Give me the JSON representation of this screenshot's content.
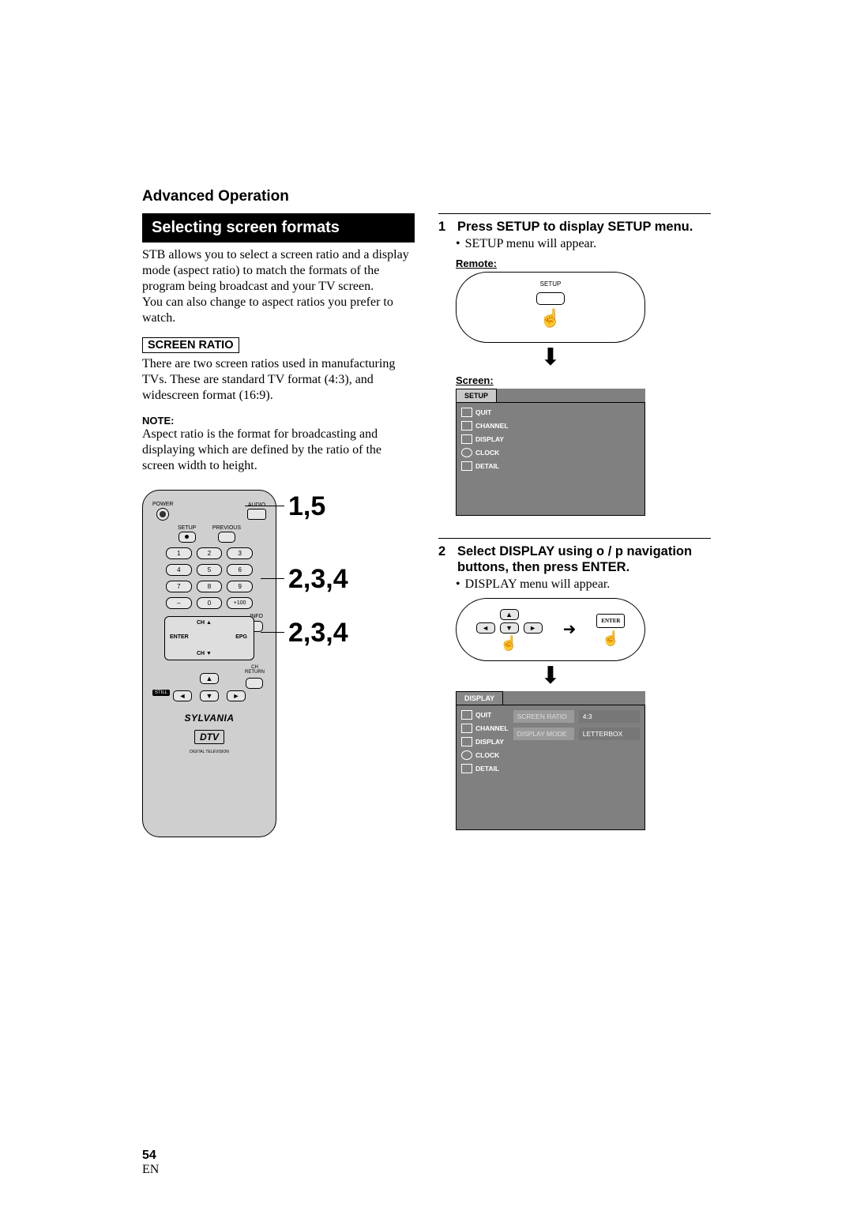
{
  "section_header": "Advanced Operation",
  "title_bar": "Selecting screen formats",
  "intro_p1": "STB allows you to select a screen ratio and a display mode (aspect ratio) to match the formats of the program being broadcast and your TV screen.",
  "intro_p2": "You can also change to aspect ratios you prefer to watch.",
  "screen_ratio_label": "SCREEN RATIO",
  "screen_ratio_body": "There are two screen ratios used in manufacturing TVs. These are standard TV format (4:3), and widescreen format (16:9).",
  "note_label": "NOTE:",
  "note_body": "Aspect ratio is the format for broadcasting and displaying which are defined by the ratio of the screen width to height.",
  "remote": {
    "power": "POWER",
    "audio": "AUDIO",
    "setup": "SETUP",
    "previous": "PREVIOUS",
    "info": "INFO",
    "nums": [
      "1",
      "2",
      "3",
      "4",
      "5",
      "6",
      "7",
      "8",
      "9",
      "–",
      "0",
      "+100"
    ],
    "ch_up": "CH ▲",
    "ch_dn": "CH ▼",
    "enter": "ENTER",
    "epg": "EPG",
    "ch_return": "CH\nRETURN",
    "still": "STILL",
    "brand": "SYLVANIA",
    "dtv": "DTV",
    "dtv_sub": "DIGITAL TELEVISION"
  },
  "callouts": {
    "a": "1,5",
    "b": "2,3,4",
    "c": "2,3,4"
  },
  "steps": [
    {
      "num": "1",
      "head": "Press SETUP to display SETUP menu.",
      "bullet": "SETUP menu will appear.",
      "remote_label": "Remote:",
      "screen_label": "Screen:",
      "setup_btn_label": "SETUP",
      "setup_tab": "SETUP",
      "menu_items": [
        "QUIT",
        "CHANNEL",
        "DISPLAY",
        "CLOCK",
        "DETAIL"
      ]
    },
    {
      "num": "2",
      "head": "Select DISPLAY using o / p navigation buttons, then press ENTER.",
      "bullet": "DISPLAY menu will appear.",
      "enter_label": "ENTER",
      "display_tab": "DISPLAY",
      "menu_items": [
        "QUIT",
        "CHANNEL",
        "DISPLAY",
        "CLOCK",
        "DETAIL"
      ],
      "options": [
        {
          "label": "SCREEN RATIO",
          "value": "4:3"
        },
        {
          "label": "DISPLAY MODE",
          "value": "LETTERBOX"
        }
      ]
    }
  ],
  "page_number": "54",
  "page_lang": "EN"
}
